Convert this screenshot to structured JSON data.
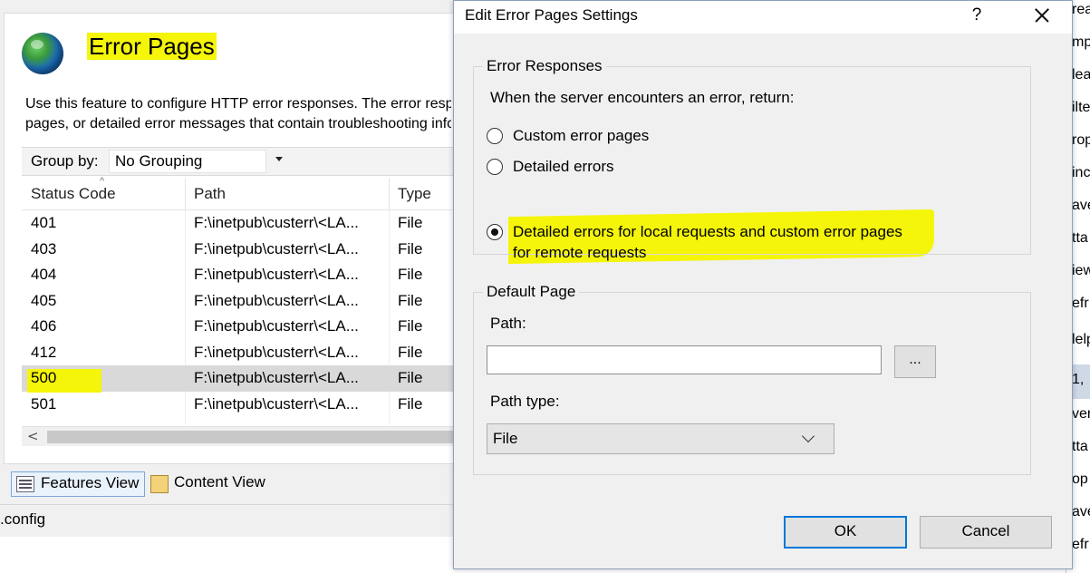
{
  "iis": {
    "title": "Error Pages",
    "description_line1": "Use this feature to configure HTTP error responses. The error responses can be custom error",
    "description_line2": "pages, or detailed error messages that contain troubleshooting information.",
    "group_by_label": "Group by:",
    "group_by_value": "No Grouping",
    "columns": [
      "Status Code",
      "Path",
      "Type"
    ],
    "rows": [
      {
        "code": "401",
        "path": "F:\\inetpub\\custerr\\<LA...",
        "type": "File"
      },
      {
        "code": "403",
        "path": "F:\\inetpub\\custerr\\<LA...",
        "type": "File"
      },
      {
        "code": "404",
        "path": "F:\\inetpub\\custerr\\<LA...",
        "type": "File"
      },
      {
        "code": "405",
        "path": "F:\\inetpub\\custerr\\<LA...",
        "type": "File"
      },
      {
        "code": "406",
        "path": "F:\\inetpub\\custerr\\<LA...",
        "type": "File"
      },
      {
        "code": "412",
        "path": "F:\\inetpub\\custerr\\<LA...",
        "type": "File"
      },
      {
        "code": "500",
        "path": "F:\\inetpub\\custerr\\<LA...",
        "type": "File"
      },
      {
        "code": "501",
        "path": "F:\\inetpub\\custerr\\<LA...",
        "type": "File"
      }
    ],
    "selected_code": "500",
    "scroll_left": "<",
    "features_view": "Features View",
    "content_view": "Content View",
    "status": ".config"
  },
  "actions": {
    "items": [
      "rea",
      "mp",
      "lea",
      "ilte",
      "rop",
      "inc",
      "ave",
      "tta",
      "iew",
      "efr",
      "lelp",
      "1,",
      "ver",
      "tta",
      "op",
      "ave",
      "efr"
    ]
  },
  "dialog": {
    "title": "Edit Error Pages Settings",
    "help": "?",
    "responses_legend": "Error Responses",
    "responses_intro": "When the server encounters an error, return:",
    "option_custom": "Custom error pages",
    "option_detailed": "Detailed errors",
    "option_local_line1": "Detailed errors for local requests and custom error pages",
    "option_local_line2": "for remote requests",
    "default_legend": "Default Page",
    "path_label": "Path:",
    "path_value": "",
    "browse": "...",
    "path_type_label": "Path type:",
    "path_type_value": "File",
    "ok": "OK",
    "cancel": "Cancel"
  },
  "colors": {
    "highlight": "#f5f50a",
    "ok_border": "#0078d7",
    "selected_row": "#d9d9d9"
  }
}
